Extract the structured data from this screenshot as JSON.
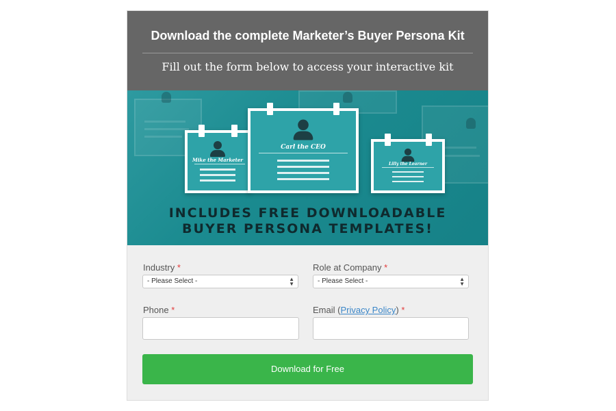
{
  "header": {
    "title": "Download the complete Marketer’s Buyer Persona Kit",
    "subtitle": "Fill out the form below to access your interactive kit"
  },
  "hero": {
    "personas": [
      {
        "name": "Mike the Marketer"
      },
      {
        "name": "Carl the CEO"
      },
      {
        "name": "Lilly the Learner"
      }
    ],
    "banner_line1": "INCLUDES FREE DOWNLOADABLE",
    "banner_line2": "BUYER PERSONA TEMPLATES!"
  },
  "form": {
    "industry": {
      "label": "Industry",
      "value": "- Please Select -"
    },
    "role": {
      "label": "Role at Company",
      "value": "- Please Select -"
    },
    "phone": {
      "label": "Phone",
      "value": ""
    },
    "email": {
      "label_prefix": "Email (",
      "link_text": "Privacy Policy",
      "label_suffix": ")",
      "value": ""
    },
    "required_mark": "*",
    "submit_label": "Download for Free"
  },
  "colors": {
    "header_bg": "#666666",
    "hero_teal": "#1b8b90",
    "button_green": "#3ab54a",
    "required_red": "#e23b3b",
    "link_blue": "#3a86c8"
  }
}
